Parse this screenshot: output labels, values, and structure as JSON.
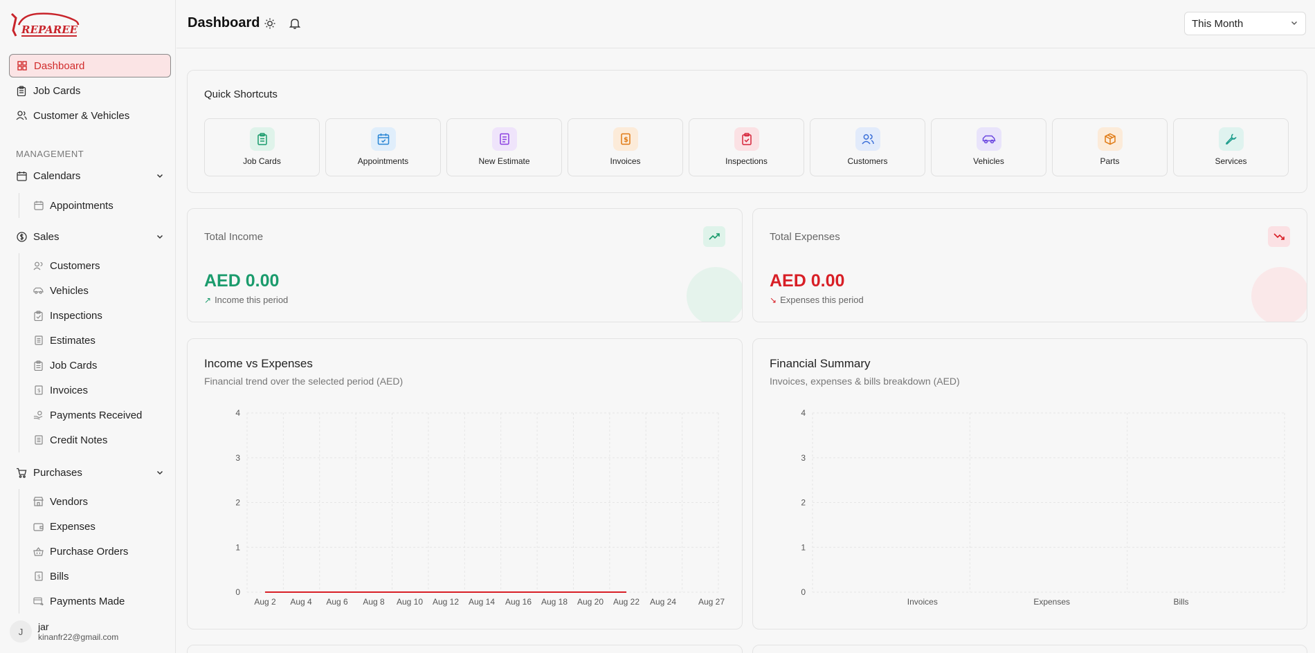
{
  "app": {
    "logo_text": "REPAREE"
  },
  "sidebar": {
    "top_items": [
      {
        "label": "Dashboard",
        "icon": "dashboard-icon",
        "active": true
      },
      {
        "label": "Job Cards",
        "icon": "clipboard-icon"
      },
      {
        "label": "Customer & Vehicles",
        "icon": "users-icon"
      }
    ],
    "section_label": "MANAGEMENT",
    "groups": {
      "calendars": {
        "label": "Calendars",
        "items": [
          {
            "label": "Appointments"
          }
        ]
      },
      "sales": {
        "label": "Sales",
        "items": [
          {
            "label": "Customers"
          },
          {
            "label": "Vehicles"
          },
          {
            "label": "Inspections"
          },
          {
            "label": "Estimates"
          },
          {
            "label": "Job Cards"
          },
          {
            "label": "Invoices"
          },
          {
            "label": "Payments Received"
          },
          {
            "label": "Credit Notes"
          }
        ]
      },
      "purchases": {
        "label": "Purchases",
        "items": [
          {
            "label": "Vendors"
          },
          {
            "label": "Expenses"
          },
          {
            "label": "Purchase Orders"
          },
          {
            "label": "Bills"
          },
          {
            "label": "Payments Made"
          }
        ]
      }
    },
    "user": {
      "initial": "J",
      "name": "jar",
      "email": "kinanfr22@gmail.com"
    }
  },
  "header": {
    "title": "Dashboard",
    "period": "This Month"
  },
  "shortcuts": {
    "title": "Quick Shortcuts",
    "items": [
      {
        "label": "Job Cards",
        "color": "#1a9b6c",
        "bg": "#dff3ea"
      },
      {
        "label": "Appointments",
        "color": "#2a86d4",
        "bg": "#e0eefb"
      },
      {
        "label": "New Estimate",
        "color": "#8a3ee0",
        "bg": "#efe4fb"
      },
      {
        "label": "Invoices",
        "color": "#e07a14",
        "bg": "#fcebd9"
      },
      {
        "label": "Inspections",
        "color": "#d6243a",
        "bg": "#fbe1e4"
      },
      {
        "label": "Customers",
        "color": "#3b6fd8",
        "bg": "#e2ebfb"
      },
      {
        "label": "Vehicles",
        "color": "#6b47e0",
        "bg": "#e9e4fb"
      },
      {
        "label": "Parts",
        "color": "#e07a14",
        "bg": "#fcebd9"
      },
      {
        "label": "Services",
        "color": "#1a9b8a",
        "bg": "#dff3ef"
      }
    ]
  },
  "kpis": {
    "income": {
      "title": "Total Income",
      "value": "AED 0.00",
      "sub": "Income this period",
      "color": "#1a9b6c"
    },
    "expenses": {
      "title": "Total Expenses",
      "value": "AED 0.00",
      "sub": "Expenses this period",
      "color": "#d81f26"
    }
  },
  "chart_data": [
    {
      "type": "line",
      "title": "Income vs Expenses",
      "subtitle": "Financial trend over the selected period (AED)",
      "x": [
        "Aug 2",
        "Aug 4",
        "Aug 6",
        "Aug 8",
        "Aug 10",
        "Aug 12",
        "Aug 14",
        "Aug 16",
        "Aug 18",
        "Aug 20",
        "Aug 22",
        "Aug 24",
        "Aug 27"
      ],
      "ylim": [
        0,
        4
      ],
      "yticks": [
        0,
        1,
        2,
        3,
        4
      ],
      "series": [
        {
          "color": "#d81f26",
          "x_range": [
            "Aug 2",
            "Aug 22"
          ],
          "values": [
            0,
            0,
            0,
            0,
            0,
            0,
            0,
            0,
            0,
            0,
            0
          ]
        }
      ],
      "grid": true
    },
    {
      "type": "bar",
      "title": "Financial Summary",
      "subtitle": "Invoices, expenses & bills breakdown (AED)",
      "categories": [
        "Invoices",
        "Expenses",
        "Bills"
      ],
      "values": [
        0,
        0,
        0
      ],
      "ylim": [
        0,
        4
      ],
      "yticks": [
        0,
        1,
        2,
        3,
        4
      ],
      "grid": true
    }
  ]
}
